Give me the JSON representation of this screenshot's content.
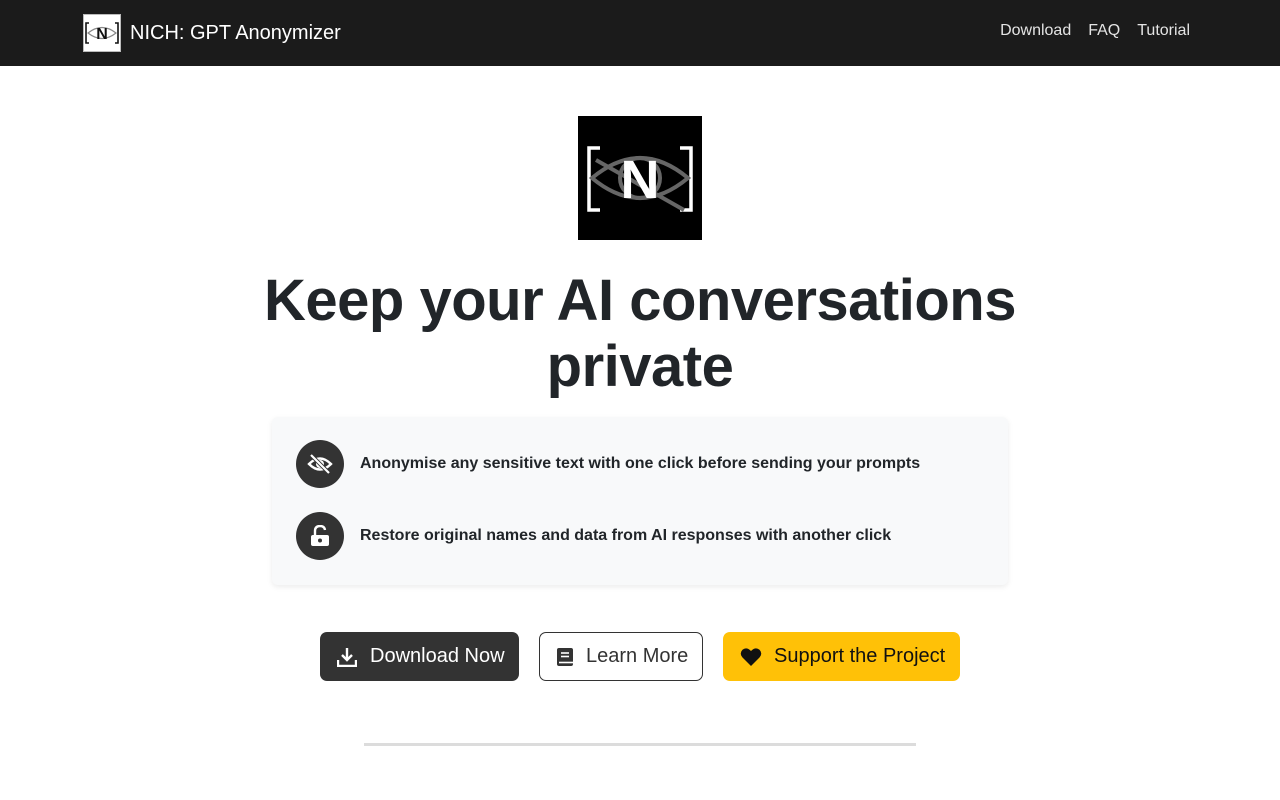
{
  "nav": {
    "brand": "NICH: GPT Anonymizer",
    "logo_letter": "N",
    "links": [
      "Download",
      "FAQ",
      "Tutorial"
    ]
  },
  "hero": {
    "logo_letter": "N",
    "title_line1": "Keep your AI conversations",
    "title_line2": "private"
  },
  "features": [
    {
      "icon": "eye-slash-icon",
      "text": "Anonymise any sensitive text with one click before sending your prompts"
    },
    {
      "icon": "unlock-icon",
      "text": "Restore original names and data from AI responses with another click"
    }
  ],
  "buttons": {
    "download": {
      "label": "Download Now",
      "icon": "download-icon"
    },
    "learn": {
      "label": "Learn More",
      "icon": "book-icon"
    },
    "support": {
      "label": "Support the Project",
      "icon": "heart-icon"
    }
  },
  "colors": {
    "navbar": "#1b1b1b",
    "dark_button": "#333333",
    "support_button": "#ffc107",
    "card_bg": "#f8f9fa"
  }
}
